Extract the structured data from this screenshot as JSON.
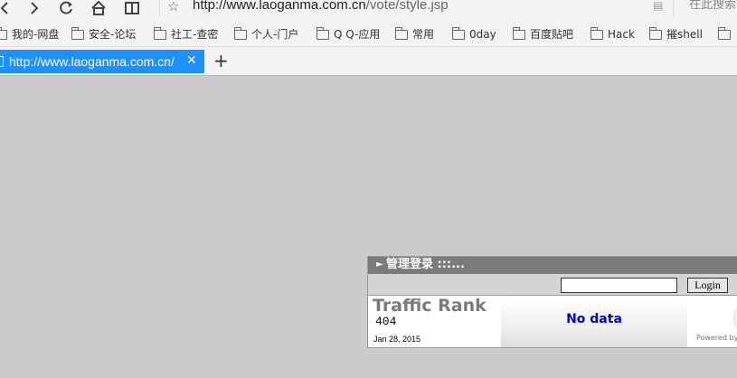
{
  "browser": {
    "address": {
      "host": "http://www.laoganma.com.cn",
      "path": "/vote/style.jsp"
    },
    "search_placeholder": "在此搜索",
    "icons": {
      "back": "◀-back-icon",
      "forward": "forward-icon",
      "reload": "reload-icon",
      "home": "home-icon",
      "reader": "reader-icon",
      "star": "star-icon",
      "search": "search-icon"
    },
    "bookmarks": [
      {
        "label": "我的-网盘"
      },
      {
        "label": "安全-论坛"
      },
      {
        "label": "社工-查密"
      },
      {
        "label": "个人-门户"
      },
      {
        "label": "Q Q-应用"
      },
      {
        "label": "常用"
      },
      {
        "label": "0day"
      },
      {
        "label": "百度贴吧"
      },
      {
        "label": "Hack"
      },
      {
        "label": "摧shell"
      }
    ],
    "tab": {
      "title": "http://www.laoganma.com.cn/",
      "close": "✕"
    },
    "new_tab": "+"
  },
  "widget": {
    "header_title": "管理登录 :::...",
    "login_button": "Login",
    "login_input_value": "",
    "rank_title": "Traffic Rank",
    "rank_value": "404",
    "rank_date": "Jan 28, 2015",
    "no_data": "No data",
    "powered_by": "Powered by"
  },
  "colors": {
    "page_bg": "#cbcbcb",
    "tab_active": "#1e90ff",
    "widget_header": "#7b7b7b",
    "no_data_text": "#0000cc"
  }
}
